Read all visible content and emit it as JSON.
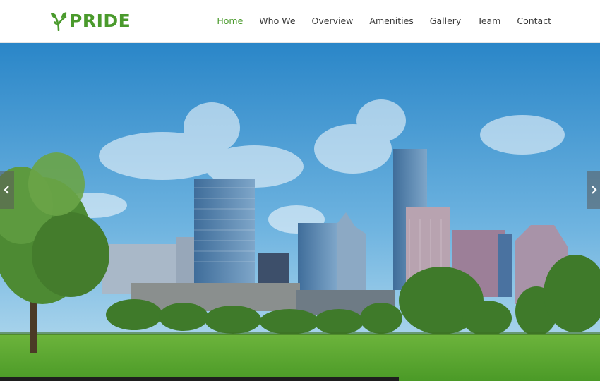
{
  "header": {
    "logo_text": "PRIDE",
    "nav": [
      "Home",
      "Who We",
      "Overview",
      "Amenities",
      "Gallery",
      "Team",
      "Contact"
    ],
    "active_index": 0
  },
  "slider": {
    "prev_icon": "chevron-left-icon",
    "next_icon": "chevron-right-icon",
    "progress": 0.665
  },
  "colors": {
    "brand_green": "#4a9a2c",
    "nav_text": "#3a3a3a",
    "sky_top": "#2a86c8",
    "sky_bottom": "#aed7ee",
    "grass": "#5aa832"
  }
}
